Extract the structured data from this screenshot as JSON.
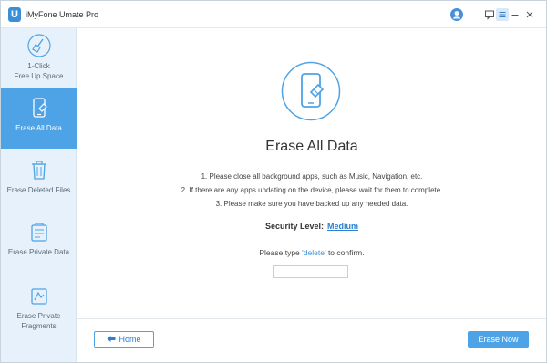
{
  "app": {
    "logo_letter": "U",
    "title": "iMyFone Umate Pro"
  },
  "titlebar": {
    "icons": [
      "user-icon",
      "feedback-icon",
      "menu-icon",
      "minimize-icon",
      "close-icon"
    ]
  },
  "sidebar": {
    "items": [
      {
        "label_line1": "1-Click",
        "label_line2": "Free Up Space",
        "icon": "broom-icon",
        "active": false
      },
      {
        "label": "Erase All Data",
        "icon": "phone-eraser-icon",
        "active": true
      },
      {
        "label": "Erase Deleted Files",
        "icon": "trash-icon",
        "active": false
      },
      {
        "label": "Erase Private Data",
        "icon": "private-data-icon",
        "active": false
      },
      {
        "label_line1": "Erase Private",
        "label_line2": "Fragments",
        "icon": "fragments-icon",
        "active": false
      }
    ]
  },
  "main": {
    "title": "Erase All Data",
    "steps": [
      "1. Please close all background apps, such as Music, Navigation, etc.",
      "2. If there are any apps updating on the device, please wait for them to complete.",
      "3. Please make sure you have backed up any needed data."
    ],
    "security_label": "Security Level:",
    "security_value": "Medium",
    "confirm_prefix": "Please type",
    "confirm_keyword": "'delete'",
    "confirm_suffix": "to confirm.",
    "confirm_input_value": "",
    "confirm_input_placeholder": ""
  },
  "footer": {
    "home_label": "Home",
    "erase_label": "Erase Now"
  },
  "colors": {
    "accent": "#4ea3e6",
    "link": "#2d7fd1",
    "sidebar_bg": "#e7f1fb"
  }
}
